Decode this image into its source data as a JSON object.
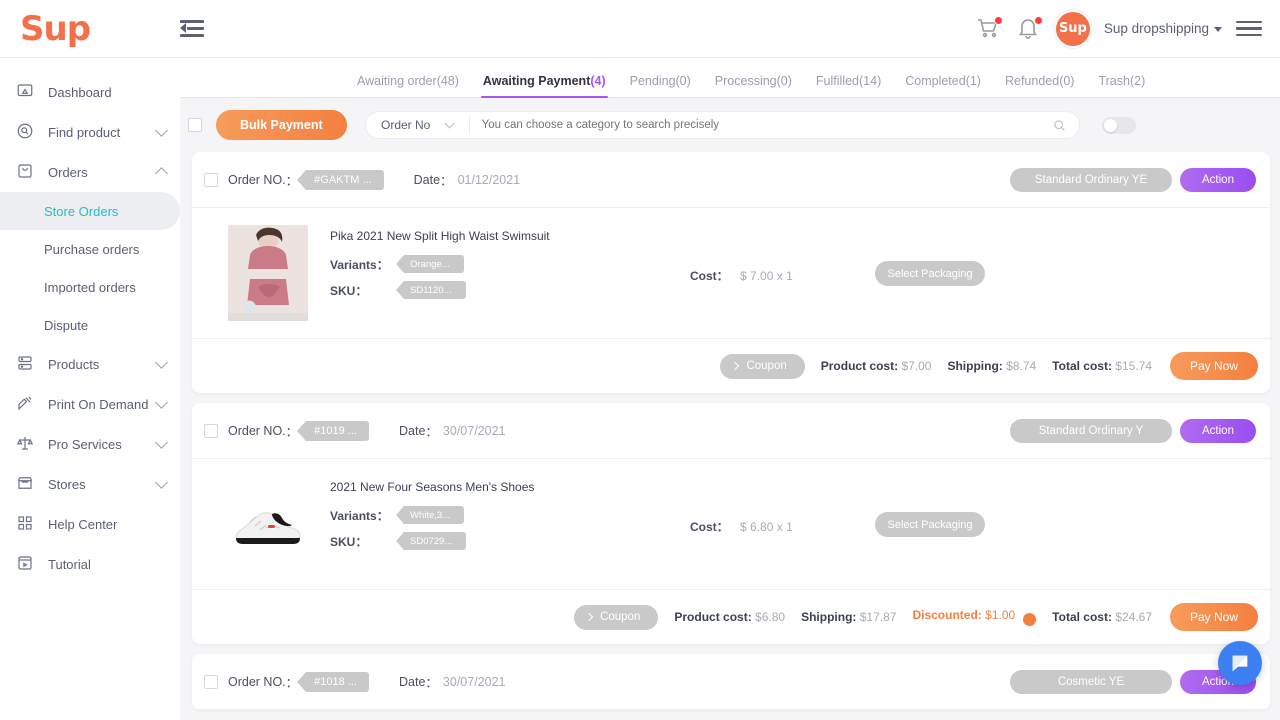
{
  "brand": {
    "logo_text": "Sup",
    "accent_orange": "#f4803f",
    "accent_purple": "#a855f7",
    "accent_teal": "#25bcc9"
  },
  "topbar": {
    "collapse_menu": "collapse-menu",
    "cart_icon": "cart-icon",
    "bell_icon": "bell-icon",
    "avatar_text": "Sup",
    "shop_name": "Sup dropshipping",
    "menu_icon": "menu-icon"
  },
  "sidebar": {
    "items": [
      {
        "label": "Dashboard",
        "icon": "dashboard-icon",
        "expandable": false
      },
      {
        "label": "Find product",
        "icon": "search-circle-icon",
        "expandable": true,
        "expanded": false
      },
      {
        "label": "Orders",
        "icon": "bag-icon",
        "expandable": true,
        "expanded": true
      },
      {
        "label": "Products",
        "icon": "products-icon",
        "expandable": true,
        "expanded": false
      },
      {
        "label": "Print On Demand",
        "icon": "print-on-demand-icon",
        "expandable": true,
        "expanded": false
      },
      {
        "label": "Pro Services",
        "icon": "scales-icon",
        "expandable": true,
        "expanded": false
      },
      {
        "label": "Stores",
        "icon": "store-icon",
        "expandable": true,
        "expanded": false
      },
      {
        "label": "Help Center",
        "icon": "help-center-icon",
        "expandable": false
      },
      {
        "label": "Tutorial",
        "icon": "tutorial-icon",
        "expandable": false
      }
    ],
    "orders_sub": [
      {
        "label": "Store Orders",
        "active": true
      },
      {
        "label": "Purchase orders",
        "active": false
      },
      {
        "label": "Imported orders",
        "active": false
      },
      {
        "label": "Dispute",
        "active": false
      }
    ]
  },
  "tabs": [
    {
      "label": "Awaiting order",
      "count": "(48)",
      "active": false
    },
    {
      "label": "Awaiting Payment",
      "count": "(4)",
      "active": true
    },
    {
      "label": "Pending",
      "count": "(0)",
      "active": false
    },
    {
      "label": "Processing",
      "count": "(0)",
      "active": false
    },
    {
      "label": "Fulfilled",
      "count": "(14)",
      "active": false
    },
    {
      "label": "Completed",
      "count": "(1)",
      "active": false
    },
    {
      "label": "Refunded",
      "count": "(0)",
      "active": false
    },
    {
      "label": "Trash",
      "count": "(2)",
      "active": false
    }
  ],
  "toolbar": {
    "bulk_payment_label": "Bulk Payment",
    "category_selected": "Order No",
    "search_placeholder": "You can choose a category to search precisely",
    "search_value": "",
    "search_icon": "search-icon",
    "toggle_on": false
  },
  "labels": {
    "order_no": "Order NO.",
    "date": "Date",
    "variants": "Variants",
    "sku": "SKU",
    "cost": "Cost",
    "coupon": "Coupon",
    "select_packaging": "Select Packaging",
    "product_cost": "Product cost:",
    "shipping": "Shipping:",
    "discounted": "Discounted:",
    "total_cost": "Total cost:",
    "pay_now": "Pay Now",
    "action": "Action"
  },
  "orders": [
    {
      "order_no": "#GAKTM ...",
      "date": "01/12/2021",
      "shipping_method": "Standard Ordinary YE",
      "action_label": "Action",
      "thumb": "swimsuit",
      "product_name": "Pika 2021 New Split High Waist Swimsuit",
      "variant": "Orange...",
      "sku": "SD1120...",
      "cost": "$ 7.00 x 1",
      "packaging_label": "Select Packaging",
      "product_cost": "$7.00",
      "shipping": "$8.74",
      "discounted": null,
      "total_cost": "$15.74",
      "pay_now": "Pay Now"
    },
    {
      "order_no": "#1019 ...",
      "date": "30/07/2021",
      "shipping_method": "Standard Ordinary Y",
      "action_label": "Action",
      "thumb": "shoe",
      "product_name": "2021 New Four Seasons Men's Shoes",
      "variant": "White,3...",
      "sku": "SD0729...",
      "cost": "$ 6.80 x 1",
      "packaging_label": "Select Packaging",
      "product_cost": "$6.80",
      "shipping": "$17.87",
      "discounted": "$1.00",
      "total_cost": "$24.67",
      "pay_now": "Pay Now"
    },
    {
      "order_no": "#1018 ...",
      "date": "30/07/2021",
      "shipping_method": "Cosmetic YE",
      "action_label": "Action",
      "thumb": null,
      "product_name": null,
      "variant": null,
      "sku": null,
      "cost": null,
      "packaging_label": null,
      "product_cost": null,
      "shipping": null,
      "discounted": null,
      "total_cost": null,
      "pay_now": null
    }
  ],
  "chat_widget": {
    "icon": "chat-bubble-icon"
  }
}
